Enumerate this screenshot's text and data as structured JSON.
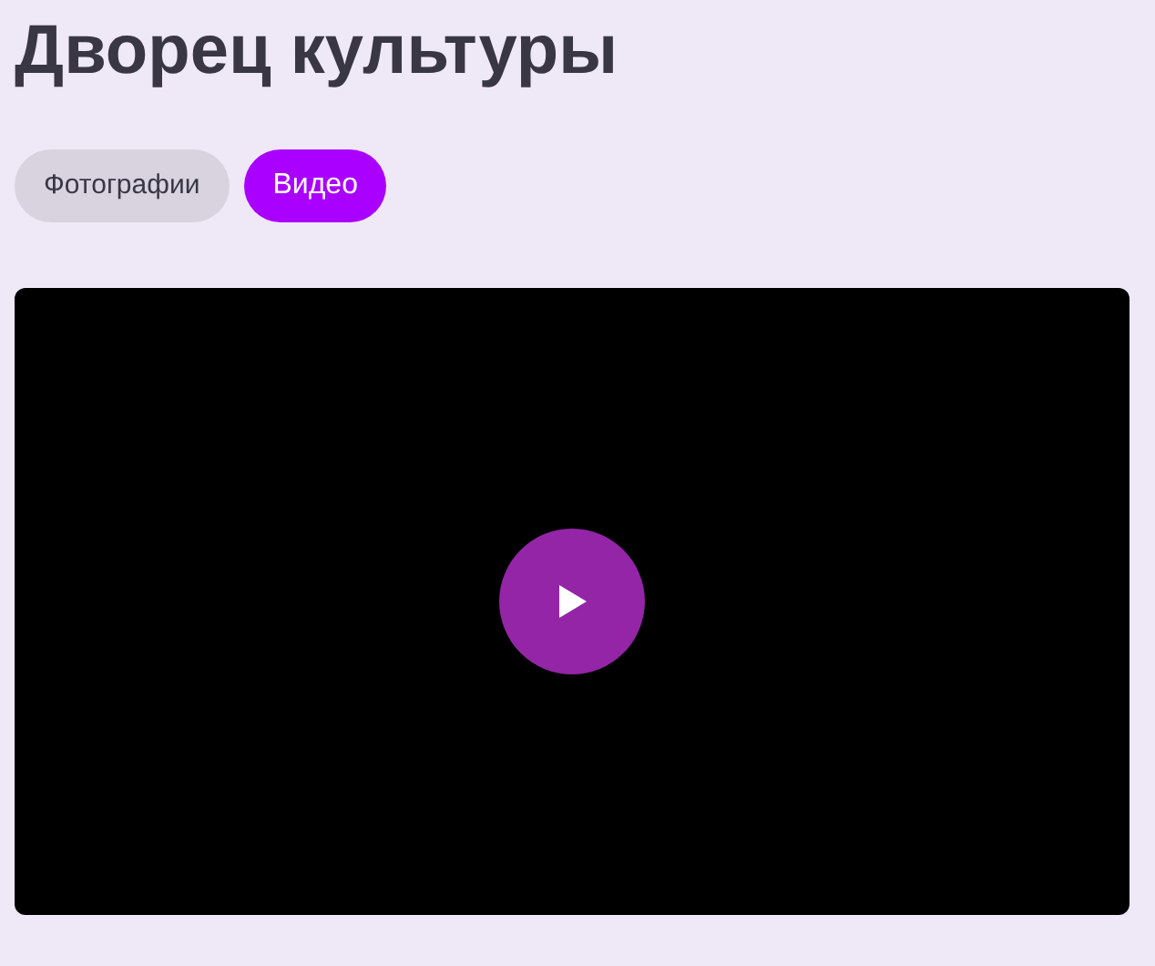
{
  "title": "Дворец культуры",
  "tabs": [
    {
      "label": "Фотографии",
      "selected": false
    },
    {
      "label": "Видео",
      "selected": true
    }
  ]
}
